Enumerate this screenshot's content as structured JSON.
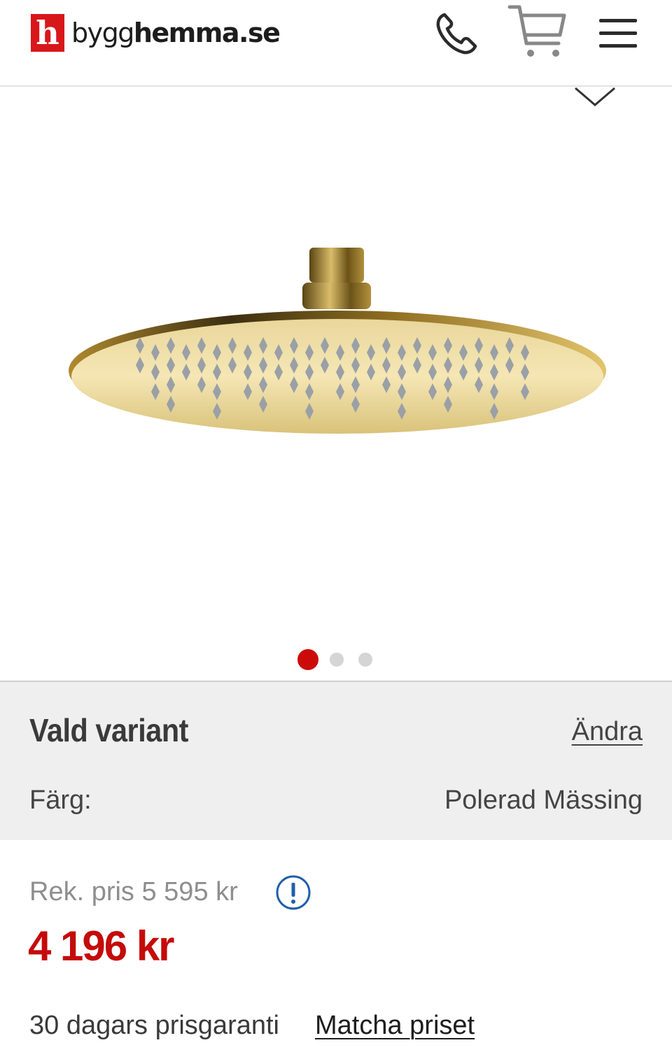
{
  "header": {
    "logo_letter": "h",
    "logo_text_regular": "bygg",
    "logo_text_bold": "hemma",
    "logo_text_suffix": ".se",
    "icons": [
      "phone-icon",
      "cart-icon",
      "menu-icon"
    ],
    "brand_color": "#d8171b"
  },
  "gallery": {
    "image_count": 3,
    "active_index": 0,
    "active_color": "#cc0a0a",
    "inactive_color": "#d5d5d5"
  },
  "variant": {
    "title": "Vald variant",
    "change_label": "Ändra",
    "color_label": "Färg:",
    "color_value": "Polerad Mässing"
  },
  "price": {
    "recommended": "Rek. pris 5 595 kr",
    "current": "4 196 kr",
    "price_color": "#c50a0a"
  },
  "guarantee": {
    "text": "30 dagars prisgaranti",
    "match_link": "Matcha priset"
  }
}
